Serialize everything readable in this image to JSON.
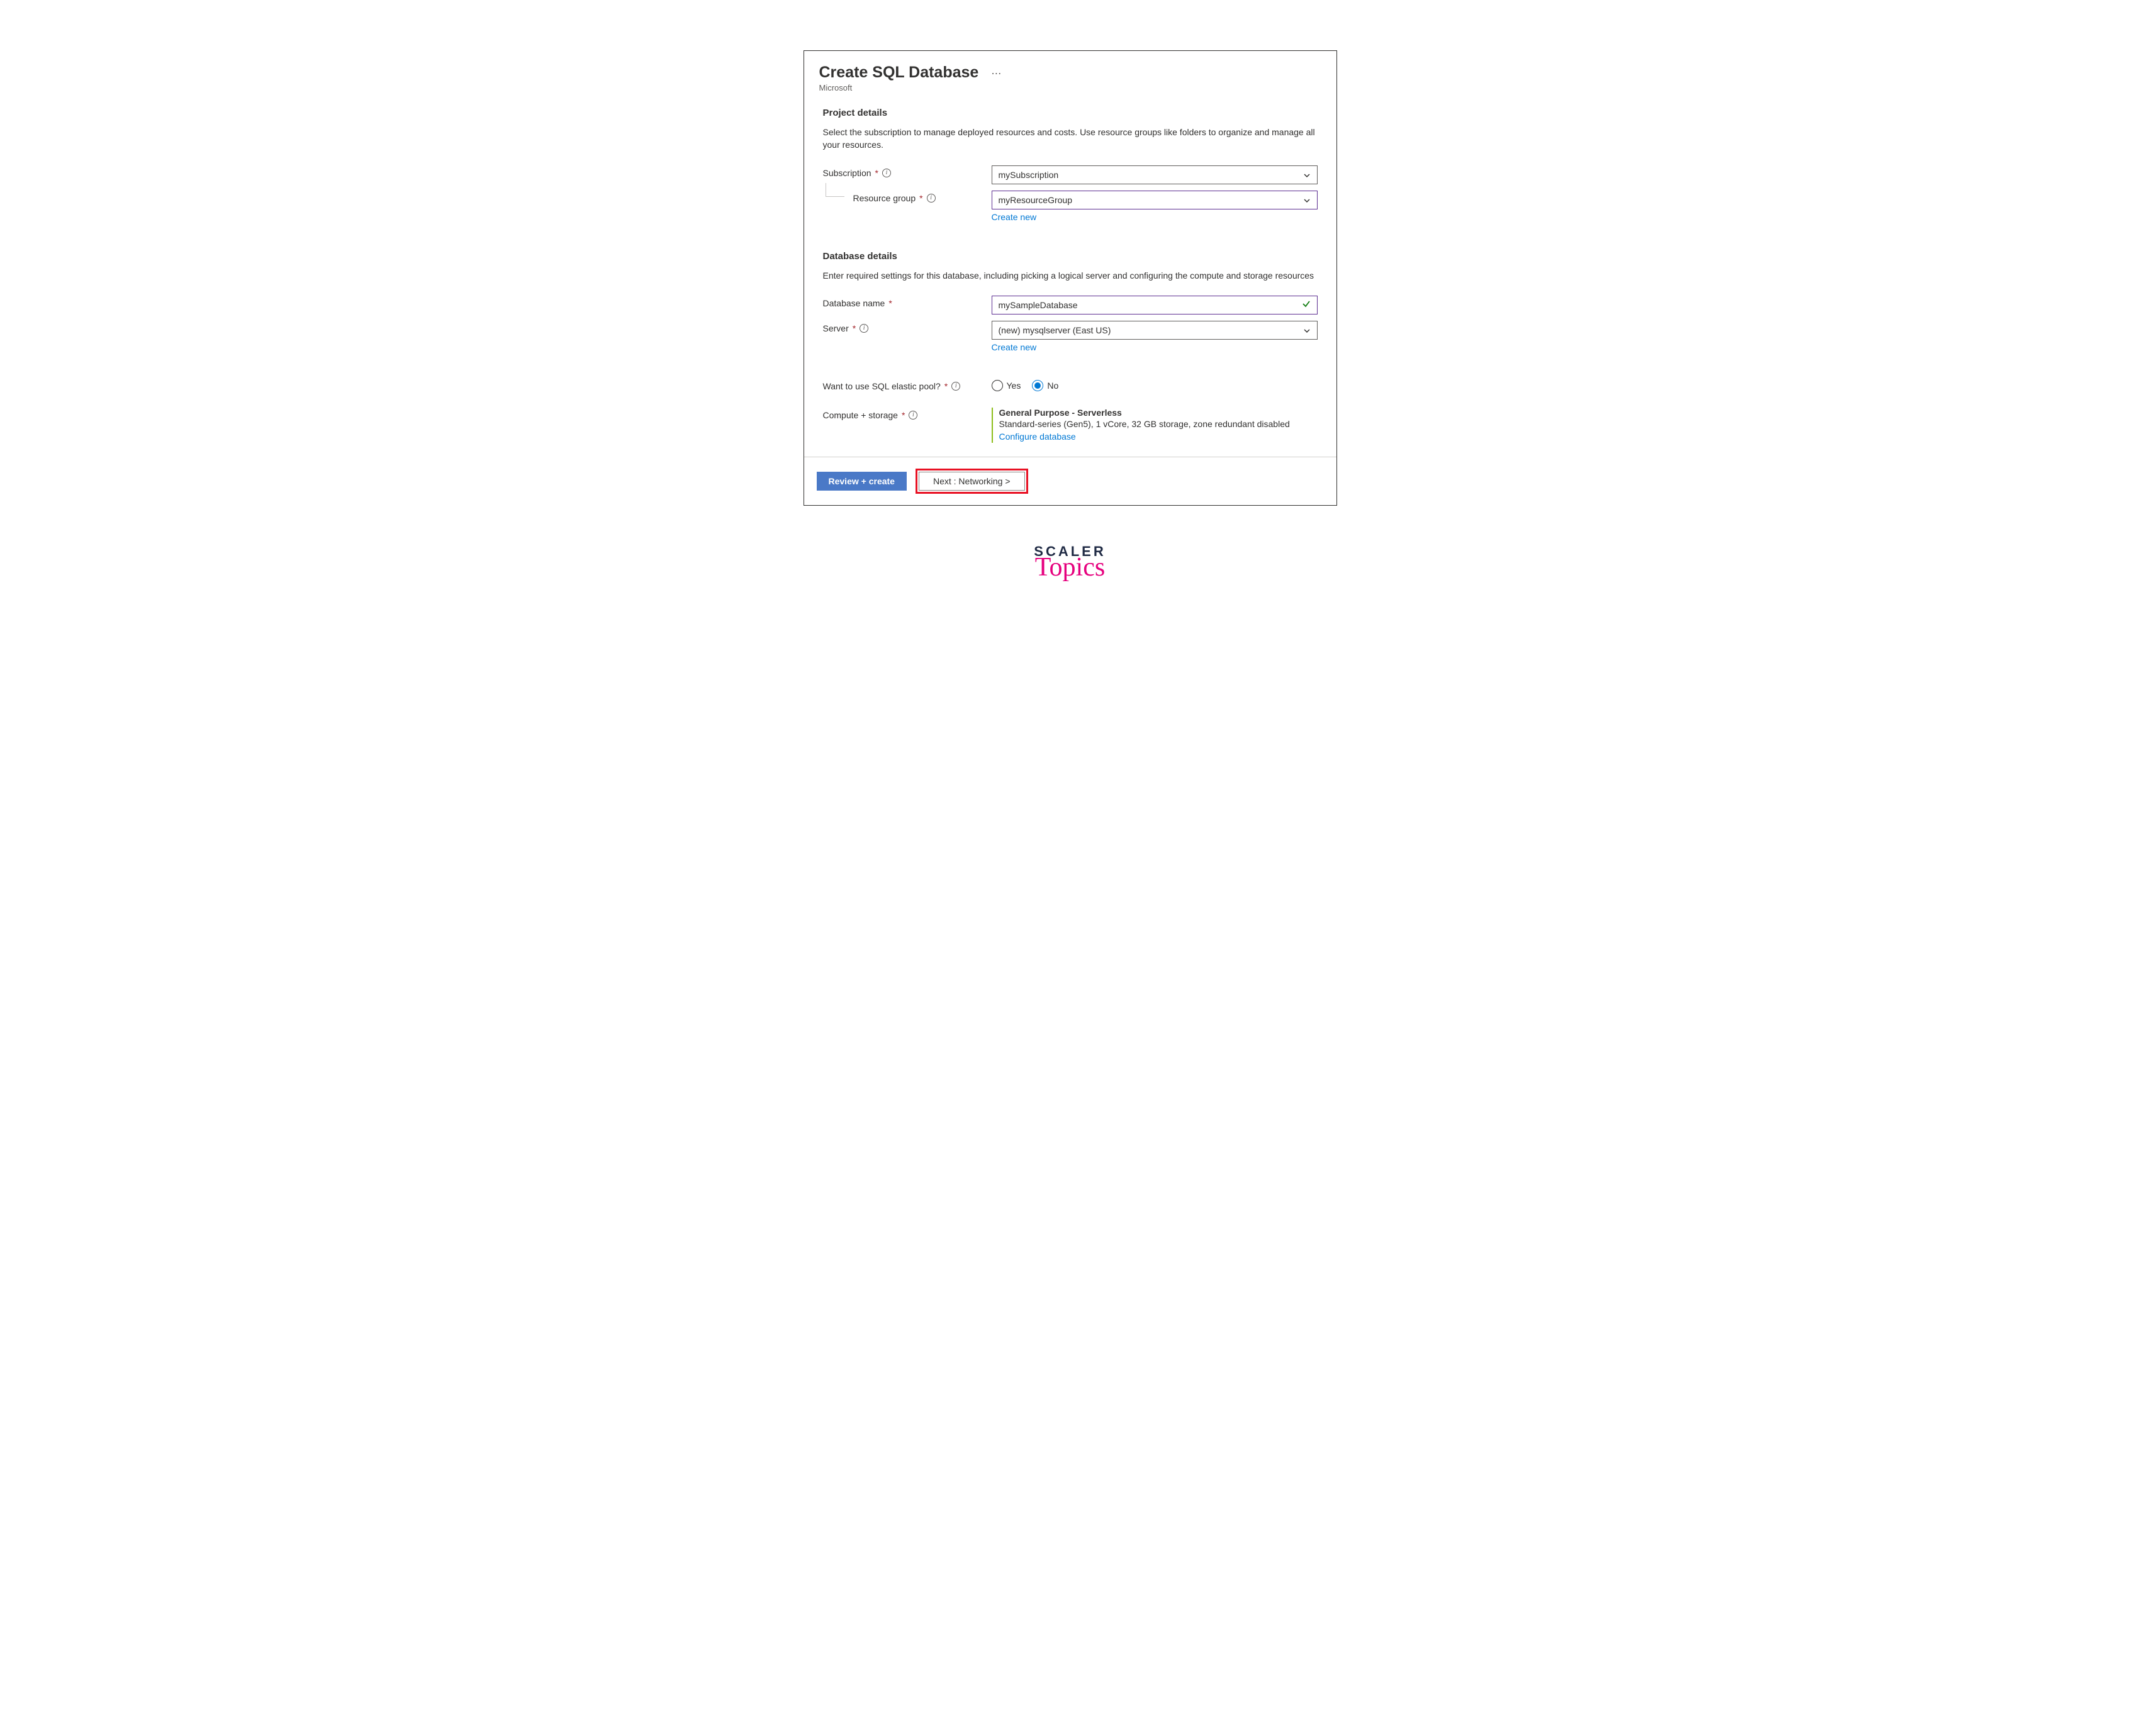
{
  "header": {
    "title": "Create SQL Database",
    "subtitle": "Microsoft"
  },
  "projectDetails": {
    "heading": "Project details",
    "description": "Select the subscription to manage deployed resources and costs. Use resource groups like folders to organize and manage all your resources.",
    "subscription": {
      "label": "Subscription",
      "value": "mySubscription"
    },
    "resourceGroup": {
      "label": "Resource group",
      "value": "myResourceGroup",
      "createNew": "Create new"
    }
  },
  "databaseDetails": {
    "heading": "Database details",
    "description": "Enter required settings for this database, including picking a logical server and configuring the compute and storage resources",
    "databaseName": {
      "label": "Database name",
      "value": "mySampleDatabase"
    },
    "server": {
      "label": "Server",
      "value": "(new) mysqlserver (East US)",
      "createNew": "Create new"
    },
    "elasticPool": {
      "label": "Want to use SQL elastic pool?",
      "yes": "Yes",
      "no": "No",
      "selected": "No"
    },
    "computeStorage": {
      "label": "Compute + storage",
      "tier": "General Purpose - Serverless",
      "spec": "Standard-series (Gen5), 1 vCore, 32 GB storage, zone redundant disabled",
      "configure": "Configure database"
    }
  },
  "footer": {
    "reviewCreate": "Review + create",
    "next": "Next : Networking >"
  },
  "watermark": {
    "line1": "SCALER",
    "line2": "Topics"
  }
}
